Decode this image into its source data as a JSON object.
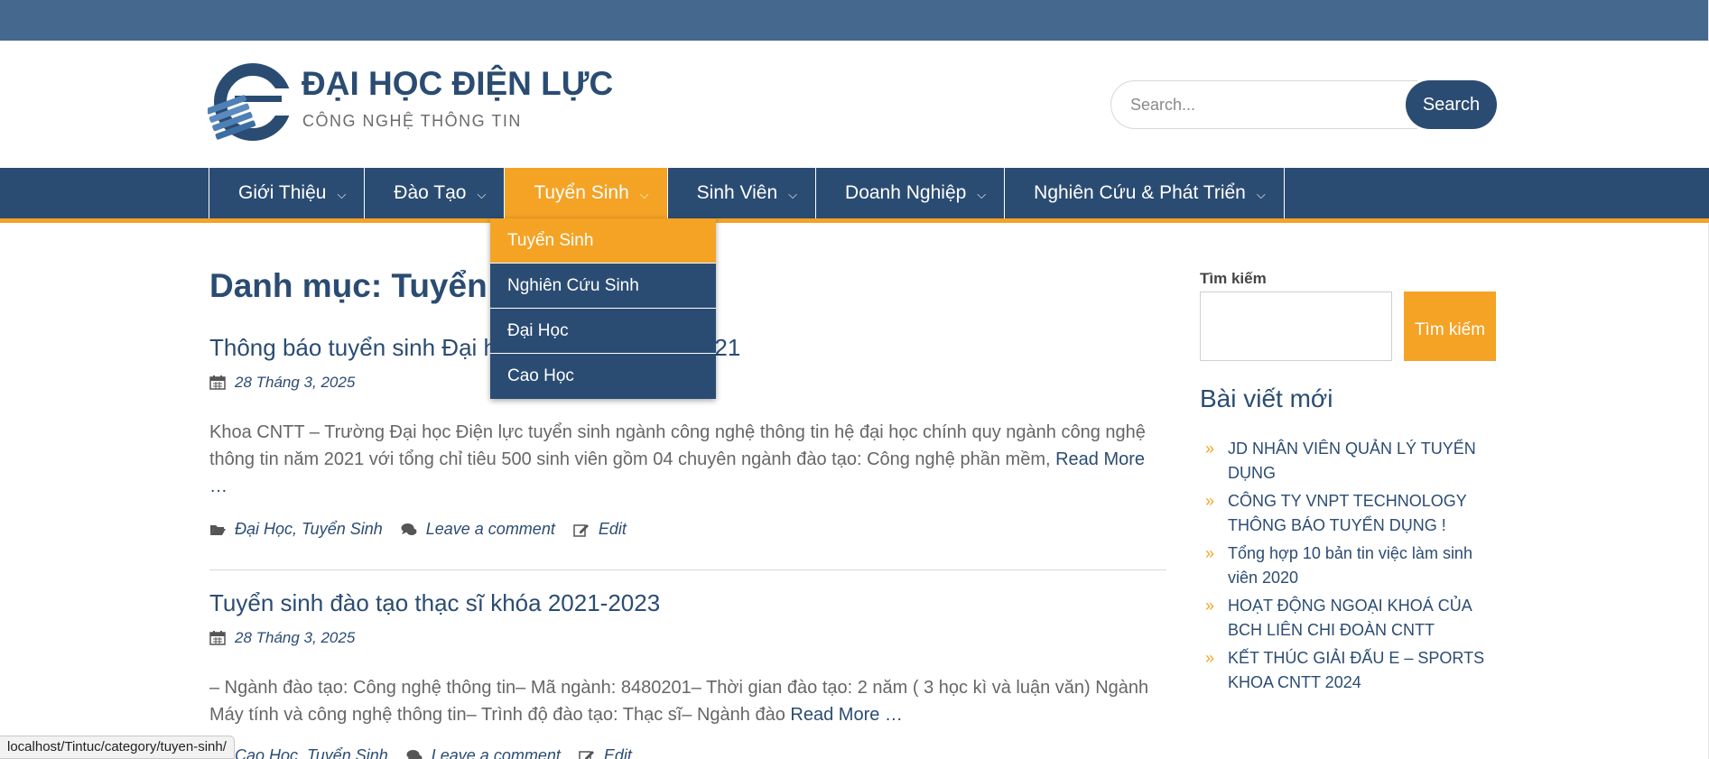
{
  "header": {
    "site_title": "ĐẠI HỌC ĐIỆN LỰC",
    "tagline": "CÔNG NGHỆ THÔNG TIN",
    "search_placeholder": "Search...",
    "search_button": "Search"
  },
  "nav": {
    "items": [
      {
        "label": "Giới Thiệu"
      },
      {
        "label": "Đào Tạo"
      },
      {
        "label": "Tuyển Sinh",
        "active": true
      },
      {
        "label": "Sinh Viên"
      },
      {
        "label": "Doanh Nghiệp"
      },
      {
        "label": "Nghiên Cứu & Phát Triển"
      }
    ],
    "chevron_icon": "chevron-down-icon"
  },
  "dropdown": {
    "items": [
      {
        "label": "Tuyển Sinh",
        "active": true
      },
      {
        "label": "Nghiên Cứu Sinh"
      },
      {
        "label": "Đại Học"
      },
      {
        "label": "Cao Học"
      }
    ]
  },
  "main": {
    "page_title": "Danh mục: Tuyển Sinh",
    "posts": [
      {
        "title": "Thông báo tuyển sinh Đại học chính quy năm 2021",
        "date": "28 Tháng 3, 2025",
        "excerpt": "Khoa CNTT – Trường Đại học Điện lực tuyển sinh ngành công nghệ thông tin hệ đại học chính quy ngành công nghệ thông tin năm 2021 với tổng chỉ tiêu 500 sinh viên gồm 04 chuyên ngành đào tạo: Công nghệ phần mềm,",
        "read_more": "Read More …",
        "categories": "Đại Học, Tuyển Sinh",
        "comment": "Leave a comment",
        "edit": "Edit"
      },
      {
        "title": "Tuyển sinh đào tạo thạc sĩ khóa 2021-2023",
        "date": "28 Tháng 3, 2025",
        "excerpt": "– Ngành đào tạo: Công nghệ thông tin– Mã ngành: 8480201– Thời gian đào tạo: 2 năm ( 3 học kì và luận văn) Ngành Máy tính và công nghệ thông tin– Trình độ đào tạo: Thạc sĩ– Ngành đào",
        "read_more": "Read More …",
        "categories": "Cao Học, Tuyển Sinh",
        "comment": "Leave a comment",
        "edit": "Edit"
      }
    ]
  },
  "sidebar": {
    "search_label": "Tìm kiếm",
    "search_button": "Tìm kiếm",
    "recent_heading": "Bài viết mới",
    "recent_posts": [
      "JD NHÂN VIÊN QUẢN LÝ TUYỂN DỤNG",
      "CÔNG TY VNPT TECHNOLOGY THÔNG BÁO TUYỂN DỤNG !",
      "Tổng hợp 10 bản tin việc làm sinh viên 2020",
      "HOẠT ĐỘNG NGOẠI KHOÁ CỦA BCH LIÊN CHI ĐOÀN CNTT",
      "KẾT THÚC GIẢI ĐẤU E – SPORTS KHOA CNTT 2024"
    ]
  },
  "statusbar": {
    "url": "localhost/Tintuc/category/tuyen-sinh/"
  },
  "colors": {
    "primary": "#2b4c72",
    "accent": "#f4a325",
    "topbar": "#45688e"
  }
}
